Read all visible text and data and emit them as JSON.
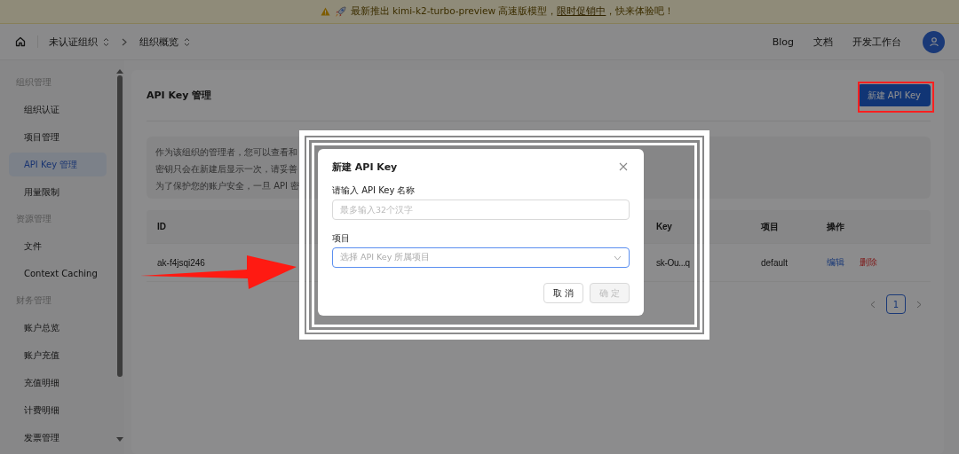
{
  "banner": {
    "before": "最新推出 kimi-k2-turbo-preview 高速版模型，",
    "link": "限时促销中",
    "after": "，快来体验吧！"
  },
  "breadcrumb": [
    {
      "label": "未认证组织"
    },
    {
      "label": "组织概览"
    }
  ],
  "nav_links": [
    "Blog",
    "文档",
    "开发工作台"
  ],
  "sidebar": {
    "groups": [
      {
        "label": "组织管理",
        "items": [
          {
            "label": "组织认证",
            "selected": false
          },
          {
            "label": "项目管理",
            "selected": false
          },
          {
            "label": "API Key 管理",
            "selected": true
          },
          {
            "label": "用量限制",
            "selected": false
          }
        ]
      },
      {
        "label": "资源管理",
        "items": [
          {
            "label": "文件",
            "selected": false
          },
          {
            "label": "Context Caching",
            "selected": false
          }
        ]
      },
      {
        "label": "财务管理",
        "items": [
          {
            "label": "账户总览",
            "selected": false
          },
          {
            "label": "账户充值",
            "selected": false
          },
          {
            "label": "充值明细",
            "selected": false
          },
          {
            "label": "计费明细",
            "selected": false
          },
          {
            "label": "发票管理",
            "selected": false
          }
        ]
      }
    ]
  },
  "page": {
    "title": "API Key 管理",
    "new_button": "新建 API Key",
    "notice": [
      "作为该组织的管理者，您可以查看和",
      "密钥只会在新建后显示一次，请妥善",
      "为了保护您的账户安全，一旦 API 密"
    ],
    "table": {
      "columns": [
        "ID",
        "Key",
        "项目",
        "操作"
      ],
      "rows": [
        {
          "id": "ak-f4jsqi246",
          "key": "sk-Ou...q",
          "project": "default",
          "actions": [
            {
              "label": "编辑",
              "kind": "edit"
            },
            {
              "label": "删除",
              "kind": "danger"
            }
          ]
        }
      ]
    },
    "pagination": [
      {
        "label": "1",
        "selected": true
      }
    ]
  },
  "dialog": {
    "title": "新建 API Key",
    "fields": [
      {
        "kind": "input",
        "label": "请输入 API Key 名称",
        "placeholder": "最多输入32个汉字",
        "focused": false
      },
      {
        "kind": "select",
        "label": "项目",
        "placeholder": "选择 API Key 所属项目",
        "focused": true
      }
    ],
    "buttons": [
      {
        "label": "取 消",
        "disabled": false
      },
      {
        "label": "确 定",
        "disabled": true
      }
    ]
  }
}
